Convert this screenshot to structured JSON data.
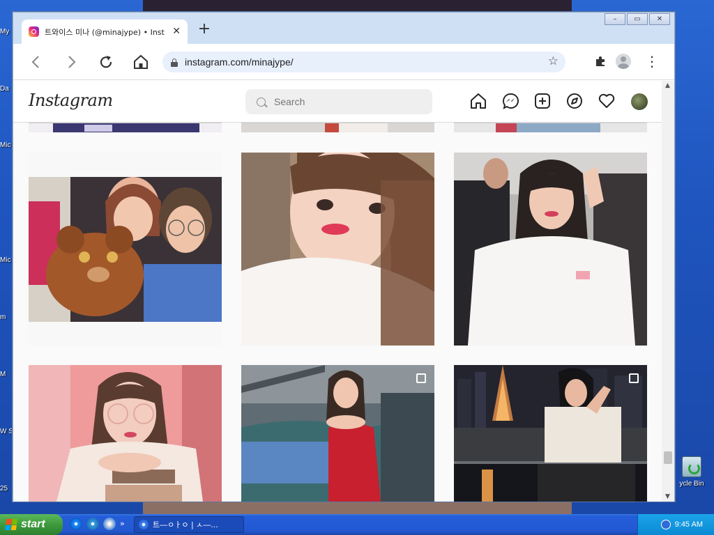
{
  "desktop": {
    "labels": [
      "My",
      "Da",
      "Mic",
      "Mic",
      "m",
      "M",
      "W\nSli",
      "25"
    ],
    "recycle_bin_label": "ycle Bin"
  },
  "browser": {
    "tab_title": "트와이스 미나 (@minajype) • Instag",
    "url": "instagram.com/minajype/",
    "new_tab": "+",
    "close_tab": "✕"
  },
  "instagram": {
    "logo": "Instagram",
    "search_placeholder": "Search",
    "nav_icons": [
      "home-icon",
      "messenger-icon",
      "new-post-icon",
      "explore-icon",
      "activity-heart-icon"
    ],
    "avatar": "profile-avatar",
    "posts": [
      {
        "type": "image",
        "desc": "two women with teddy bear"
      },
      {
        "type": "image",
        "desc": "selfie white shirt"
      },
      {
        "type": "image",
        "desc": "airport white tee"
      },
      {
        "type": "image",
        "desc": "glasses pink background"
      },
      {
        "type": "carousel",
        "desc": "red dress stadium"
      },
      {
        "type": "carousel",
        "desc": "night city tower"
      }
    ]
  },
  "taskbar": {
    "start_label": "start",
    "task_label": "트―ㅇㅏㅇ | ㅅ―...",
    "clock": "9:45 AM",
    "quick_chevron": "»"
  }
}
